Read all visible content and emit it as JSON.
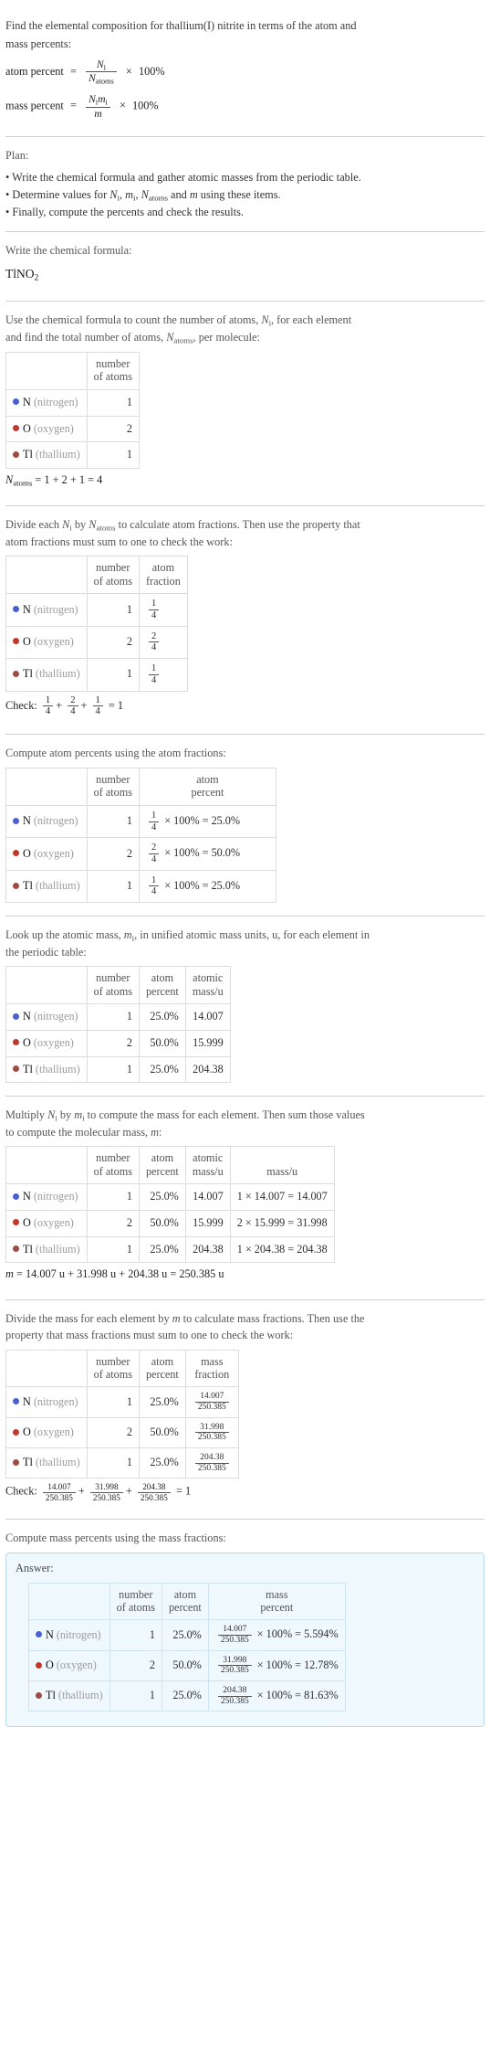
{
  "colors": {
    "N": "#4a5fd0",
    "O": "#c0392b",
    "Tl": "#9e4b42",
    "answer_bg": "#eef8fd",
    "answer_border": "#b9d9e8"
  },
  "intro": {
    "line1": "Find the elemental composition for thallium(I) nitrite in terms of the atom and",
    "line2": "mass percents:",
    "atom_percent_label": "atom percent",
    "mass_percent_label": "mass percent",
    "eq": "=",
    "times": "×",
    "hundred": "100%",
    "Ni": "N",
    "Ni_sub": "i",
    "Natoms": "N",
    "Natoms_sub": "atoms",
    "Nimi_num_N": "N",
    "Nimi_num_N_sub": "i",
    "Nimi_num_m": "m",
    "Nimi_num_m_sub": "i",
    "m": "m"
  },
  "plan": {
    "title": "Plan:",
    "items": [
      "• Write the chemical formula and gather atomic masses from the periodic table.",
      "• Determine values for N_i, m_i, N_atoms and m using these items.",
      "• Finally, compute the percents and check the results."
    ],
    "item2_parts": {
      "pre": "• Determine values for ",
      "a": "N",
      "a_sub": "i",
      "sep1": ", ",
      "b": "m",
      "b_sub": "i",
      "sep2": ", ",
      "c": "N",
      "c_sub": "atoms",
      "mid": " and ",
      "d": "m",
      "post": " using these items."
    }
  },
  "formula_step": {
    "prompt": "Write the chemical formula:",
    "formula_parts": [
      {
        "t": "TlNO",
        "sub": ""
      },
      {
        "t": "",
        "sub": "2"
      }
    ],
    "formula_text": "TlNO2",
    "formula_main": "TlNO",
    "formula_sub": "2"
  },
  "count_step": {
    "prompt_line1": "Use the chemical formula to count the number of atoms, N_i, for each element",
    "prompt_line2": "and find the total number of atoms, N_atoms, per molecule:",
    "p1_a": "Use the chemical formula to count the number of atoms, ",
    "p1_N": "N",
    "p1_N_sub": "i",
    "p1_b": ", for each element",
    "p2_a": "and find the total number of atoms, ",
    "p2_N": "N",
    "p2_N_sub": "atoms",
    "p2_b": ", per molecule:",
    "headers": [
      "",
      "number\nof atoms"
    ],
    "header_number_of_atoms_l1": "number",
    "header_number_of_atoms_l2": "of atoms",
    "rows": [
      {
        "sym": "N",
        "name": "(nitrogen)",
        "count": "1"
      },
      {
        "sym": "O",
        "name": "(oxygen)",
        "count": "2"
      },
      {
        "sym": "Tl",
        "name": "(thallium)",
        "count": "1"
      }
    ],
    "total_N": "N",
    "total_N_sub": "atoms",
    "total_expr": "= 1 + 2 + 1 = 4"
  },
  "fraction_step": {
    "prompt_line1_a": "Divide each ",
    "prompt_line1_N": "N",
    "prompt_line1_N_sub": "i",
    "prompt_line1_b": " by ",
    "prompt_line1_N2": "N",
    "prompt_line1_N2_sub": "atoms",
    "prompt_line1_c": " to calculate atom fractions. Then use the property that",
    "prompt_line2": "atom fractions must sum to one to check the work:",
    "header_num_l1": "number",
    "header_num_l2": "of atoms",
    "header_frac_l1": "atom",
    "header_frac_l2": "fraction",
    "rows": [
      {
        "sym": "N",
        "name": "(nitrogen)",
        "count": "1",
        "num": "1",
        "den": "4"
      },
      {
        "sym": "O",
        "name": "(oxygen)",
        "count": "2",
        "num": "2",
        "den": "4"
      },
      {
        "sym": "Tl",
        "name": "(thallium)",
        "count": "1",
        "num": "1",
        "den": "4"
      }
    ],
    "check_label": "Check:",
    "check_terms": [
      {
        "num": "1",
        "den": "4"
      },
      {
        "num": "2",
        "den": "4"
      },
      {
        "num": "1",
        "den": "4"
      }
    ],
    "check_result": "= 1"
  },
  "atom_percent_step": {
    "prompt": "Compute atom percents using the atom fractions:",
    "header_num_l1": "number",
    "header_num_l2": "of atoms",
    "header_pct_l1": "atom",
    "header_pct_l2": "percent",
    "rows": [
      {
        "sym": "N",
        "name": "(nitrogen)",
        "count": "1",
        "num": "1",
        "den": "4",
        "result": "× 100% = 25.0%"
      },
      {
        "sym": "O",
        "name": "(oxygen)",
        "count": "2",
        "num": "2",
        "den": "4",
        "result": "× 100% = 50.0%"
      },
      {
        "sym": "Tl",
        "name": "(thallium)",
        "count": "1",
        "num": "1",
        "den": "4",
        "result": "× 100% = 25.0%"
      }
    ]
  },
  "mass_lookup_step": {
    "prompt_a": "Look up the atomic mass, ",
    "prompt_m": "m",
    "prompt_m_sub": "i",
    "prompt_b": ", in unified atomic mass units, u, for each element in",
    "prompt_line2": "the periodic table:",
    "header_num_l1": "number",
    "header_num_l2": "of atoms",
    "header_pct_l1": "atom",
    "header_pct_l2": "percent",
    "header_mass_l1": "atomic",
    "header_mass_l2": "mass/u",
    "rows": [
      {
        "sym": "N",
        "name": "(nitrogen)",
        "count": "1",
        "pct": "25.0%",
        "mass": "14.007"
      },
      {
        "sym": "O",
        "name": "(oxygen)",
        "count": "2",
        "pct": "50.0%",
        "mass": "15.999"
      },
      {
        "sym": "Tl",
        "name": "(thallium)",
        "count": "1",
        "pct": "25.0%",
        "mass": "204.38"
      }
    ]
  },
  "molecular_mass_step": {
    "prompt_a": "Multiply ",
    "prompt_N": "N",
    "prompt_N_sub": "i",
    "prompt_b": " by ",
    "prompt_m": "m",
    "prompt_m_sub": "i",
    "prompt_c": " to compute the mass for each element. Then sum those values",
    "prompt_line2_a": "to compute the molecular mass, ",
    "prompt_line2_m": "m",
    "prompt_line2_b": ":",
    "header_num_l1": "number",
    "header_num_l2": "of atoms",
    "header_pct_l1": "atom",
    "header_pct_l2": "percent",
    "header_mass_l1": "atomic",
    "header_mass_l2": "mass/u",
    "header_massu": "mass/u",
    "rows": [
      {
        "sym": "N",
        "name": "(nitrogen)",
        "count": "1",
        "pct": "25.0%",
        "mass": "14.007",
        "product": "1 × 14.007 = 14.007"
      },
      {
        "sym": "O",
        "name": "(oxygen)",
        "count": "2",
        "pct": "50.0%",
        "mass": "15.999",
        "product": "2 × 15.999 = 31.998"
      },
      {
        "sym": "Tl",
        "name": "(thallium)",
        "count": "1",
        "pct": "25.0%",
        "mass": "204.38",
        "product": "1 × 204.38 = 204.38"
      }
    ],
    "total_m": "m",
    "total_expr": "= 14.007 u + 31.998 u + 204.38 u = 250.385 u"
  },
  "mass_fraction_step": {
    "prompt_line1_a": "Divide the mass for each element by ",
    "prompt_line1_m": "m",
    "prompt_line1_b": " to calculate mass fractions. Then use the",
    "prompt_line2": "property that mass fractions must sum to one to check the work:",
    "header_num_l1": "number",
    "header_num_l2": "of atoms",
    "header_pct_l1": "atom",
    "header_pct_l2": "percent",
    "header_frac_l1": "mass",
    "header_frac_l2": "fraction",
    "rows": [
      {
        "sym": "N",
        "name": "(nitrogen)",
        "count": "1",
        "pct": "25.0%",
        "num": "14.007",
        "den": "250.385"
      },
      {
        "sym": "O",
        "name": "(oxygen)",
        "count": "2",
        "pct": "50.0%",
        "num": "31.998",
        "den": "250.385"
      },
      {
        "sym": "Tl",
        "name": "(thallium)",
        "count": "1",
        "pct": "25.0%",
        "num": "204.38",
        "den": "250.385"
      }
    ],
    "check_label": "Check:",
    "check_terms": [
      {
        "num": "14.007",
        "den": "250.385"
      },
      {
        "num": "31.998",
        "den": "250.385"
      },
      {
        "num": "204.38",
        "den": "250.385"
      }
    ],
    "check_result": "= 1"
  },
  "final_step": {
    "prompt": "Compute mass percents using the mass fractions:",
    "answer_label": "Answer:",
    "header_num_l1": "number",
    "header_num_l2": "of atoms",
    "header_atompct_l1": "atom",
    "header_atompct_l2": "percent",
    "header_masspct_l1": "mass",
    "header_masspct_l2": "percent",
    "rows": [
      {
        "sym": "N",
        "name": "(nitrogen)",
        "count": "1",
        "atom_pct": "25.0%",
        "num": "14.007",
        "den": "250.385",
        "result": "× 100% = 5.594%"
      },
      {
        "sym": "O",
        "name": "(oxygen)",
        "count": "2",
        "atom_pct": "50.0%",
        "num": "31.998",
        "den": "250.385",
        "result": "× 100% = 12.78%"
      },
      {
        "sym": "Tl",
        "name": "(thallium)",
        "count": "1",
        "atom_pct": "25.0%",
        "num": "204.38",
        "den": "250.385",
        "result": "× 100% = 81.63%"
      }
    ]
  },
  "chart_data": {
    "type": "table",
    "title": "Elemental composition of thallium(I) nitrite (TlNO2)",
    "categories": [
      "N (nitrogen)",
      "O (oxygen)",
      "Tl (thallium)"
    ],
    "number_of_atoms": [
      1,
      2,
      1
    ],
    "atom_fraction": [
      "1/4",
      "2/4",
      "1/4"
    ],
    "atom_percent": [
      25.0,
      50.0,
      25.0
    ],
    "atomic_mass_u": [
      14.007,
      15.999,
      204.38
    ],
    "mass_contribution_u": [
      14.007,
      31.998,
      204.38
    ],
    "mass_fraction": [
      "14.007/250.385",
      "31.998/250.385",
      "204.38/250.385"
    ],
    "mass_percent": [
      5.594,
      12.78,
      81.63
    ],
    "total_atoms": 4,
    "molecular_mass_u": 250.385
  }
}
